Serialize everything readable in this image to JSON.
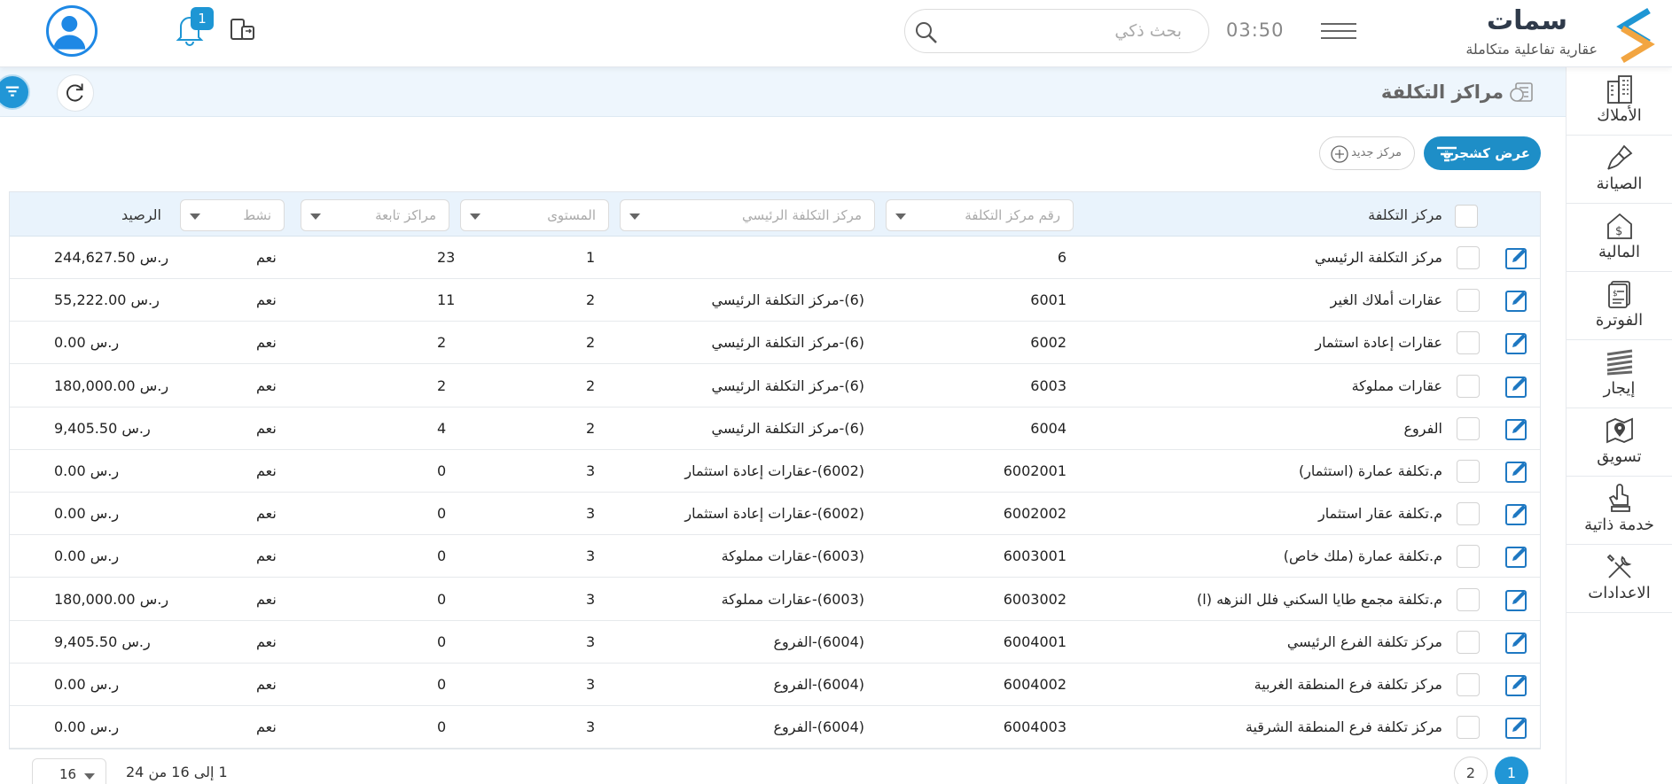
{
  "app": {
    "name": "سمات",
    "tagline": "عقارية تفاعلية متكاملة",
    "accent_color": "#1e8ec7"
  },
  "header": {
    "time": "03:50",
    "search_placeholder": "بحث ذكي",
    "notification_count": "1"
  },
  "sidebar": {
    "items": [
      {
        "label": "الأملاك",
        "icon": "buildings-icon"
      },
      {
        "label": "الصيانة",
        "icon": "brush-icon"
      },
      {
        "label": "المالية",
        "icon": "finance-house-icon"
      },
      {
        "label": "الفوترة",
        "icon": "invoice-icon"
      },
      {
        "label": "إيجار",
        "icon": "rent-stack-icon"
      },
      {
        "label": "تسويق",
        "icon": "map-pin-icon"
      },
      {
        "label": "خدمة ذاتية",
        "icon": "self-service-icon"
      },
      {
        "label": "الاعدادات",
        "icon": "tools-icon"
      }
    ]
  },
  "page": {
    "title": "مراكز التكلفة",
    "tree_button": "عرض كشجرة",
    "new_button": "مركز جديد"
  },
  "table": {
    "headers": {
      "name": "مركز التكلفة",
      "code": "رقم مركز التكلفة",
      "parent": "مركز التكلفة الرئيسي",
      "level": "المستوى",
      "sub": "مراكز تابعة",
      "active": "نشط",
      "balance": "الرصيد"
    },
    "rows": [
      {
        "name": "مركز التكلفة الرئيسي",
        "code": "6",
        "parent": "",
        "level": "1",
        "sub": "23",
        "active": "نعم",
        "balance": "244,627.50 ر.س"
      },
      {
        "name": "عقارات أملاك الغير",
        "code": "6001",
        "parent": "(6)-مركز التكلفة الرئيسي",
        "level": "2",
        "sub": "11",
        "active": "نعم",
        "balance": "55,222.00 ر.س"
      },
      {
        "name": "عقارات إعادة استثمار",
        "code": "6002",
        "parent": "(6)-مركز التكلفة الرئيسي",
        "level": "2",
        "sub": "2",
        "active": "نعم",
        "balance": "0.00 ر.س"
      },
      {
        "name": "عقارات مملوكة",
        "code": "6003",
        "parent": "(6)-مركز التكلفة الرئيسي",
        "level": "2",
        "sub": "2",
        "active": "نعم",
        "balance": "180,000.00 ر.س"
      },
      {
        "name": "الفروع",
        "code": "6004",
        "parent": "(6)-مركز التكلفة الرئيسي",
        "level": "2",
        "sub": "4",
        "active": "نعم",
        "balance": "9,405.50 ر.س"
      },
      {
        "name": "م.تكلفة عمارة (استثمار)",
        "code": "6002001",
        "parent": "(6002)-عقارات إعادة استثمار",
        "level": "3",
        "sub": "0",
        "active": "نعم",
        "balance": "0.00 ر.س"
      },
      {
        "name": "م.تكلفة عقار استثمار",
        "code": "6002002",
        "parent": "(6002)-عقارات إعادة استثمار",
        "level": "3",
        "sub": "0",
        "active": "نعم",
        "balance": "0.00 ر.س"
      },
      {
        "name": "م.تكلفة عمارة (ملك خاص)",
        "code": "6003001",
        "parent": "(6003)-عقارات مملوكة",
        "level": "3",
        "sub": "0",
        "active": "نعم",
        "balance": "0.00 ر.س"
      },
      {
        "name": "م.تكلفة مجمع طايا السكني فلل النزهه (ا)",
        "code": "6003002",
        "parent": "(6003)-عقارات مملوكة",
        "level": "3",
        "sub": "0",
        "active": "نعم",
        "balance": "180,000.00 ر.س"
      },
      {
        "name": "مركز تكلفة الفرع الرئيسي",
        "code": "6004001",
        "parent": "(6004)-الفروع",
        "level": "3",
        "sub": "0",
        "active": "نعم",
        "balance": "9,405.50 ر.س"
      },
      {
        "name": "مركز تكلفة فرع المنطقة الغربية",
        "code": "6004002",
        "parent": "(6004)-الفروع",
        "level": "3",
        "sub": "0",
        "active": "نعم",
        "balance": "0.00 ر.س"
      },
      {
        "name": "مركز تكلفة فرع المنطقة الشرقية",
        "code": "6004003",
        "parent": "(6004)-الفروع",
        "level": "3",
        "sub": "0",
        "active": "نعم",
        "balance": "0.00 ر.س"
      }
    ]
  },
  "pagination": {
    "page_size": "16",
    "range": "1 إلى 16 من 24",
    "pages": [
      "1",
      "2"
    ],
    "current": "1"
  }
}
